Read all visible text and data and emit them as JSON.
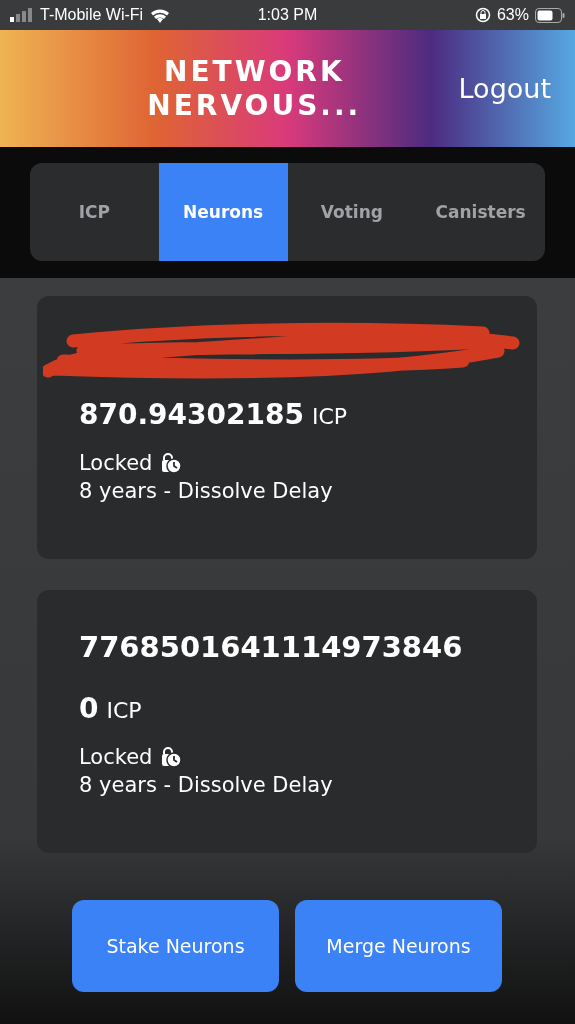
{
  "status_bar": {
    "carrier": "T-Mobile Wi-Fi",
    "time": "1:03 PM",
    "battery": "63%"
  },
  "header": {
    "title_lines": [
      "NETWORK",
      "NERVOUS..."
    ],
    "logout": "Logout"
  },
  "tabs": [
    {
      "label": "ICP",
      "selected": false
    },
    {
      "label": "Neurons",
      "selected": true
    },
    {
      "label": "Voting",
      "selected": false
    },
    {
      "label": "Canisters",
      "selected": false
    }
  ],
  "neurons": [
    {
      "redacted": true,
      "amount": "870.94302185",
      "unit": "ICP",
      "state": "Locked",
      "delay": "8 years - Dissolve Delay"
    },
    {
      "redacted": false,
      "id": "7768501641114973846",
      "amount": "0",
      "unit": "ICP",
      "state": "Locked",
      "delay": "8 years - Dissolve Delay"
    }
  ],
  "buttons": [
    "Stake Neurons",
    "Merge Neurons"
  ]
}
